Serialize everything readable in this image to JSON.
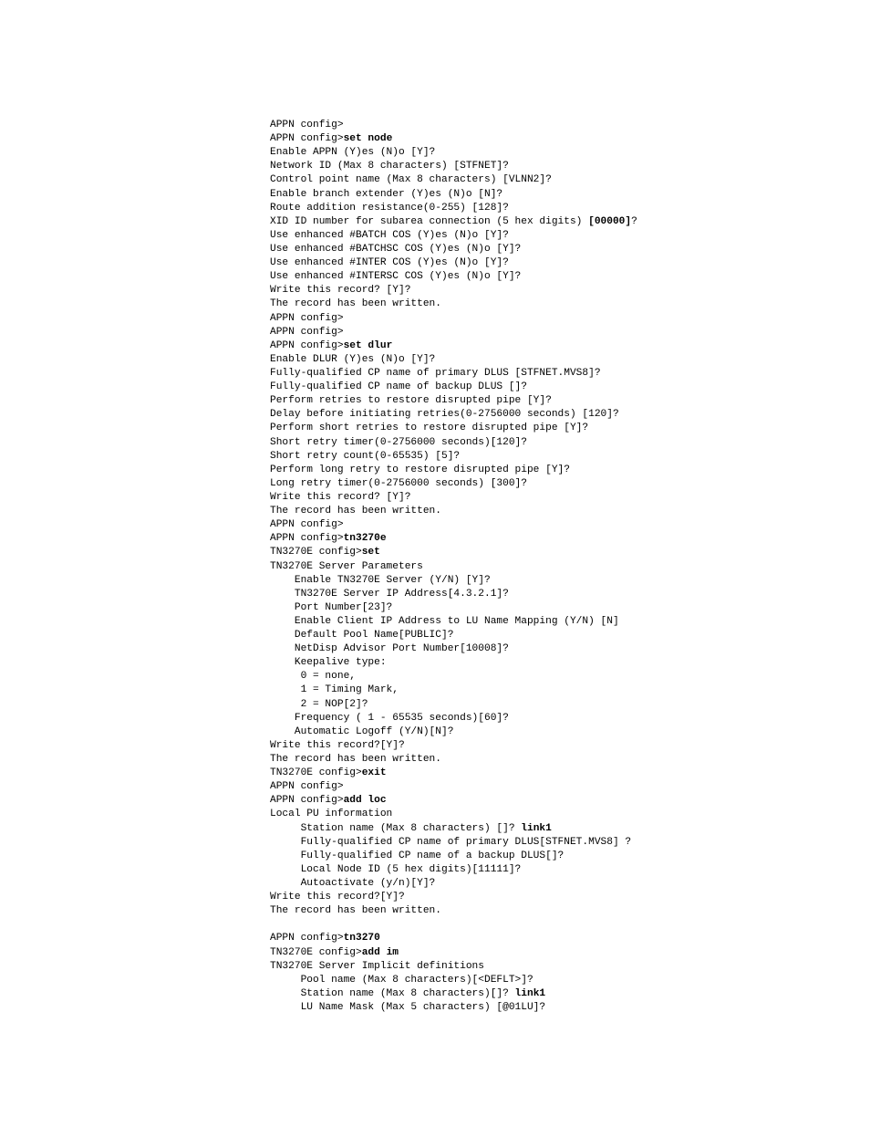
{
  "lines": [
    {
      "t": "APPN config>"
    },
    {
      "segs": [
        {
          "t": "APPN config>"
        },
        {
          "t": "set node",
          "b": true
        }
      ]
    },
    {
      "t": "Enable APPN (Y)es (N)o [Y]?"
    },
    {
      "t": "Network ID (Max 8 characters) [STFNET]?"
    },
    {
      "t": "Control point name (Max 8 characters) [VLNN2]?"
    },
    {
      "t": "Enable branch extender (Y)es (N)o [N]?"
    },
    {
      "t": "Route addition resistance(0-255) [128]?"
    },
    {
      "segs": [
        {
          "t": "XID ID number for subarea connection (5 hex digits) "
        },
        {
          "t": "[00000]",
          "b": true
        },
        {
          "t": "?"
        }
      ]
    },
    {
      "t": "Use enhanced #BATCH COS (Y)es (N)o [Y]?"
    },
    {
      "t": "Use enhanced #BATCHSC COS (Y)es (N)o [Y]?"
    },
    {
      "t": "Use enhanced #INTER COS (Y)es (N)o [Y]?"
    },
    {
      "t": "Use enhanced #INTERSC COS (Y)es (N)o [Y]?"
    },
    {
      "t": "Write this record? [Y]?"
    },
    {
      "t": "The record has been written."
    },
    {
      "t": "APPN config>"
    },
    {
      "t": "APPN config>"
    },
    {
      "segs": [
        {
          "t": "APPN config>"
        },
        {
          "t": "set dlur",
          "b": true
        }
      ]
    },
    {
      "t": "Enable DLUR (Y)es (N)o [Y]?"
    },
    {
      "t": "Fully-qualified CP name of primary DLUS [STFNET.MVS8]?"
    },
    {
      "t": "Fully-qualified CP name of backup DLUS []?"
    },
    {
      "t": "Perform retries to restore disrupted pipe [Y]?"
    },
    {
      "t": "Delay before initiating retries(0-2756000 seconds) [120]?"
    },
    {
      "t": "Perform short retries to restore disrupted pipe [Y]?"
    },
    {
      "t": "Short retry timer(0-2756000 seconds)[120]?"
    },
    {
      "t": "Short retry count(0-65535) [5]?"
    },
    {
      "t": "Perform long retry to restore disrupted pipe [Y]?"
    },
    {
      "t": "Long retry timer(0-2756000 seconds) [300]?"
    },
    {
      "t": "Write this record? [Y]?"
    },
    {
      "t": "The record has been written."
    },
    {
      "t": "APPN config>"
    },
    {
      "segs": [
        {
          "t": "APPN config>"
        },
        {
          "t": "tn3270e",
          "b": true
        }
      ]
    },
    {
      "segs": [
        {
          "t": "TN3270E config>"
        },
        {
          "t": "set",
          "b": true
        }
      ]
    },
    {
      "t": "TN3270E Server Parameters"
    },
    {
      "t": "    Enable TN3270E Server (Y/N) [Y]?"
    },
    {
      "t": "    TN3270E Server IP Address[4.3.2.1]?"
    },
    {
      "t": "    Port Number[23]?"
    },
    {
      "t": "    Enable Client IP Address to LU Name Mapping (Y/N) [N]"
    },
    {
      "t": "    Default Pool Name[PUBLIC]?"
    },
    {
      "t": "    NetDisp Advisor Port Number[10008]?"
    },
    {
      "t": "    Keepalive type:"
    },
    {
      "t": "     0 = none,"
    },
    {
      "t": "     1 = Timing Mark,"
    },
    {
      "t": "     2 = NOP[2]?"
    },
    {
      "t": "    Frequency ( 1 - 65535 seconds)[60]?"
    },
    {
      "t": "    Automatic Logoff (Y/N)[N]?"
    },
    {
      "t": "Write this record?[Y]?"
    },
    {
      "t": "The record has been written."
    },
    {
      "segs": [
        {
          "t": "TN3270E config>"
        },
        {
          "t": "exit",
          "b": true
        }
      ]
    },
    {
      "t": "APPN config>"
    },
    {
      "segs": [
        {
          "t": "APPN config>"
        },
        {
          "t": "add loc",
          "b": true
        }
      ]
    },
    {
      "t": "Local PU information"
    },
    {
      "segs": [
        {
          "t": "     Station name (Max 8 characters) []? "
        },
        {
          "t": "link1",
          "b": true
        }
      ]
    },
    {
      "t": "     Fully-qualified CP name of primary DLUS[STFNET.MVS8] ?"
    },
    {
      "t": "     Fully-qualified CP name of a backup DLUS[]?"
    },
    {
      "t": "     Local Node ID (5 hex digits)[11111]?"
    },
    {
      "t": "     Autoactivate (y/n)[Y]?"
    },
    {
      "t": "Write this record?[Y]?"
    },
    {
      "t": "The record has been written."
    },
    {
      "t": ""
    },
    {
      "segs": [
        {
          "t": "APPN config>"
        },
        {
          "t": "tn3270",
          "b": true
        }
      ]
    },
    {
      "segs": [
        {
          "t": "TN3270E config>"
        },
        {
          "t": "add im",
          "b": true
        }
      ]
    },
    {
      "t": "TN3270E Server Implicit definitions"
    },
    {
      "t": "     Pool name (Max 8 characters)[<DEFLT>]?"
    },
    {
      "segs": [
        {
          "t": "     Station name (Max 8 characters)[]? "
        },
        {
          "t": "link1",
          "b": true
        }
      ]
    },
    {
      "t": "     LU Name Mask (Max 5 characters) [@01LU]?"
    }
  ]
}
